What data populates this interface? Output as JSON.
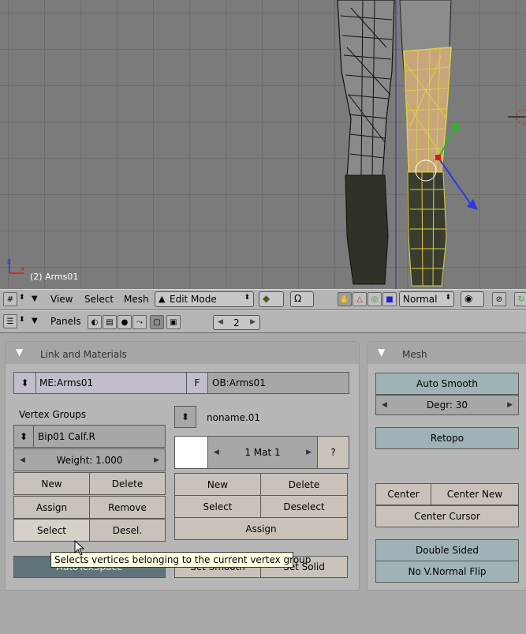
{
  "viewport": {
    "object_label": "(2) Arms01"
  },
  "header_3d": {
    "menus": [
      "View",
      "Select",
      "Mesh"
    ],
    "mode": "Edit Mode",
    "orientation": "Normal"
  },
  "header_buttons": {
    "panels_label": "Panels",
    "frame_value": "2"
  },
  "link_materials": {
    "title": "Link and Materials",
    "mesh_name": "ME:Arms01",
    "f_label": "F",
    "object_name": "OB:Arms01",
    "vertex_groups_label": "Vertex Groups",
    "vertex_group": "Bip01 Calf.R",
    "weight": "Weight: 1.000",
    "vg_buttons": {
      "new": "New",
      "delete": "Delete",
      "assign": "Assign",
      "remove": "Remove",
      "select": "Select",
      "desel": "Desel."
    },
    "material_name": "noname.01",
    "material_index": "1 Mat 1",
    "question": "?",
    "mat_buttons": {
      "new": "New",
      "delete": "Delete",
      "select": "Select",
      "deselect": "Deselect",
      "assign": "Assign"
    },
    "autotexspace": "AutoTexSpace",
    "set_smooth": "Set Smooth",
    "set_solid": "Set Solid"
  },
  "mesh_panel": {
    "title": "Mesh",
    "auto_smooth": "Auto Smooth",
    "degr": "Degr: 30",
    "retopo": "Retopo",
    "center": "Center",
    "center_new": "Center New",
    "center_cursor": "Center Cursor",
    "double_sided": "Double Sided",
    "no_vnormal_flip": "No V.Normal Flip"
  },
  "tooltip": "Selects vertices belonging to the current vertex group",
  "colors": {
    "viewport_bg": "#7b7b7b",
    "selected_mesh": "#d8d04a",
    "panel_bg": "#b6b6b6",
    "button": "#c9c2ba",
    "toggle_blue": "#9fb2b6"
  }
}
